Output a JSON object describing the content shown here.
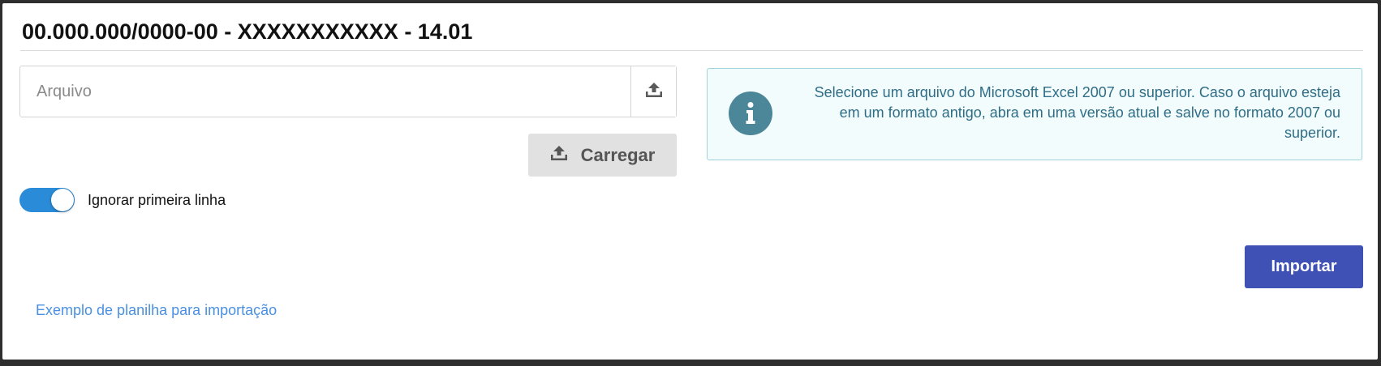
{
  "dialog": {
    "title": "00.000.000/0000-00 - XXXXXXXXXXX - 14.01"
  },
  "file_input": {
    "placeholder": "Arquivo",
    "value": "",
    "browse_icon": "upload-icon"
  },
  "load_button": {
    "label": "Carregar",
    "icon": "upload-icon"
  },
  "toggle": {
    "label": "Ignorar primeira linha",
    "checked": true,
    "color": "#2a8bd8"
  },
  "info": {
    "icon": "info-icon",
    "text": "Selecione um arquivo do Microsoft Excel 2007 ou superior. Caso o arquivo esteja em um formato antigo, abra em uma versão atual e salve no formato 2007 ou superior.",
    "background": "#f2fcfd",
    "text_color": "#2f6d86"
  },
  "import_button": {
    "label": "Importar",
    "color": "#3f51b5"
  },
  "example_link": {
    "label": "Exemplo de planilha para importação",
    "color": "#4a90e2"
  }
}
